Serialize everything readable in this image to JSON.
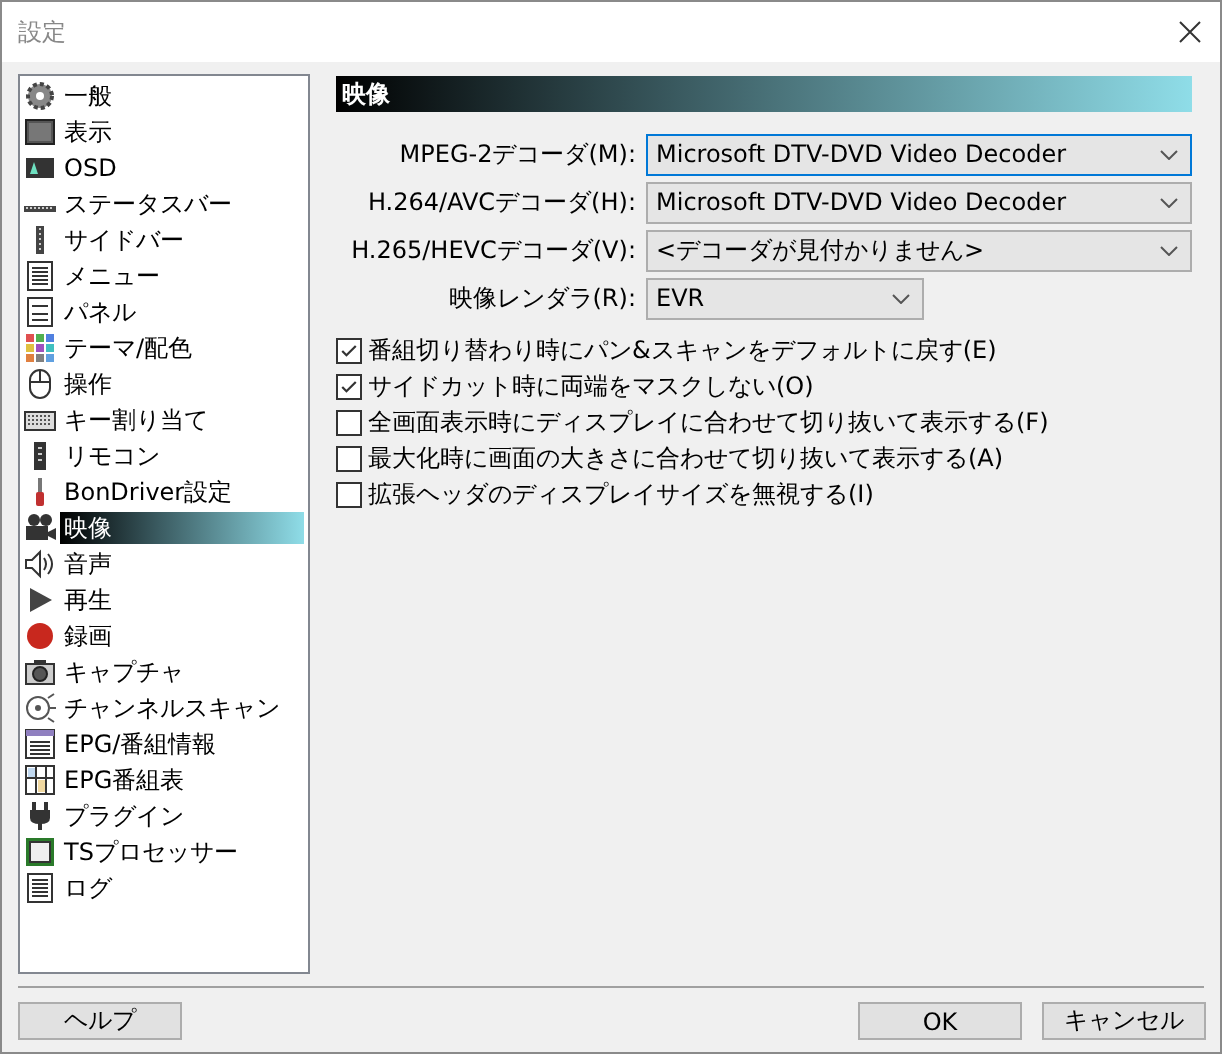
{
  "window": {
    "title": "設定"
  },
  "sidebar": {
    "items": [
      {
        "label": "一般",
        "selected": false
      },
      {
        "label": "表示",
        "selected": false
      },
      {
        "label": "OSD",
        "selected": false
      },
      {
        "label": "ステータスバー",
        "selected": false
      },
      {
        "label": "サイドバー",
        "selected": false
      },
      {
        "label": "メニュー",
        "selected": false
      },
      {
        "label": "パネル",
        "selected": false
      },
      {
        "label": "テーマ/配色",
        "selected": false
      },
      {
        "label": "操作",
        "selected": false
      },
      {
        "label": "キー割り当て",
        "selected": false
      },
      {
        "label": "リモコン",
        "selected": false
      },
      {
        "label": "BonDriver設定",
        "selected": false
      },
      {
        "label": "映像",
        "selected": true
      },
      {
        "label": "音声",
        "selected": false
      },
      {
        "label": "再生",
        "selected": false
      },
      {
        "label": "録画",
        "selected": false
      },
      {
        "label": "キャプチャ",
        "selected": false
      },
      {
        "label": "チャンネルスキャン",
        "selected": false
      },
      {
        "label": "EPG/番組情報",
        "selected": false
      },
      {
        "label": "EPG番組表",
        "selected": false
      },
      {
        "label": "プラグイン",
        "selected": false
      },
      {
        "label": "TSプロセッサー",
        "selected": false
      },
      {
        "label": "ログ",
        "selected": false
      }
    ]
  },
  "panel": {
    "title": "映像",
    "selects": [
      {
        "label": "MPEG-2デコーダ(M):",
        "value": "Microsoft DTV-DVD Video Decoder",
        "focused": true
      },
      {
        "label": "H.264/AVCデコーダ(H):",
        "value": "Microsoft DTV-DVD Video Decoder",
        "focused": false
      },
      {
        "label": "H.265/HEVCデコーダ(V):",
        "value": "<デコーダが見付かりません>",
        "focused": false
      },
      {
        "label": "映像レンダラ(R):",
        "value": "EVR",
        "focused": false
      }
    ],
    "checkboxes": [
      {
        "label": "番組切り替わり時にパン&スキャンをデフォルトに戻す(E)",
        "checked": true
      },
      {
        "label": "サイドカット時に両端をマスクしない(O)",
        "checked": true
      },
      {
        "label": "全画面表示時にディスプレイに合わせて切り抜いて表示する(F)",
        "checked": false
      },
      {
        "label": "最大化時に画面の大きさに合わせて切り抜いて表示する(A)",
        "checked": false
      },
      {
        "label": "拡張ヘッダのディスプレイサイズを無視する(I)",
        "checked": false
      }
    ]
  },
  "buttons": {
    "help": "ヘルプ",
    "ok": "OK",
    "cancel": "キャンセル"
  }
}
